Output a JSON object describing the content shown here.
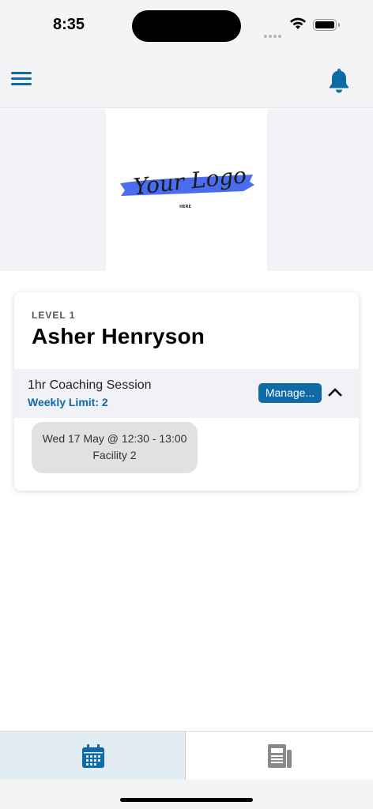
{
  "status_bar": {
    "time": "8:35"
  },
  "header": {
    "menu_icon": "hamburger-menu-icon",
    "notification_icon": "bell-icon",
    "accent_color": "#0e6ba5"
  },
  "banner": {
    "logo_text": "Your Logo",
    "logo_subtext": "HERE",
    "logo_brush_color": "#4a6cf0"
  },
  "member": {
    "level": "LEVEL 1",
    "name": "Asher Henryson"
  },
  "session": {
    "title": "1hr Coaching Session",
    "weekly_limit": "Weekly Limit: 2",
    "manage_label": "Manage...",
    "toggle_icon": "chevron-up-icon"
  },
  "booking": {
    "when": "Wed 17 May @ 12:30 - 13:00",
    "where": "Facility 2"
  },
  "tabs": [
    {
      "name": "calendar",
      "icon": "calendar-icon",
      "active": true
    },
    {
      "name": "news",
      "icon": "newspaper-icon",
      "active": false
    }
  ]
}
